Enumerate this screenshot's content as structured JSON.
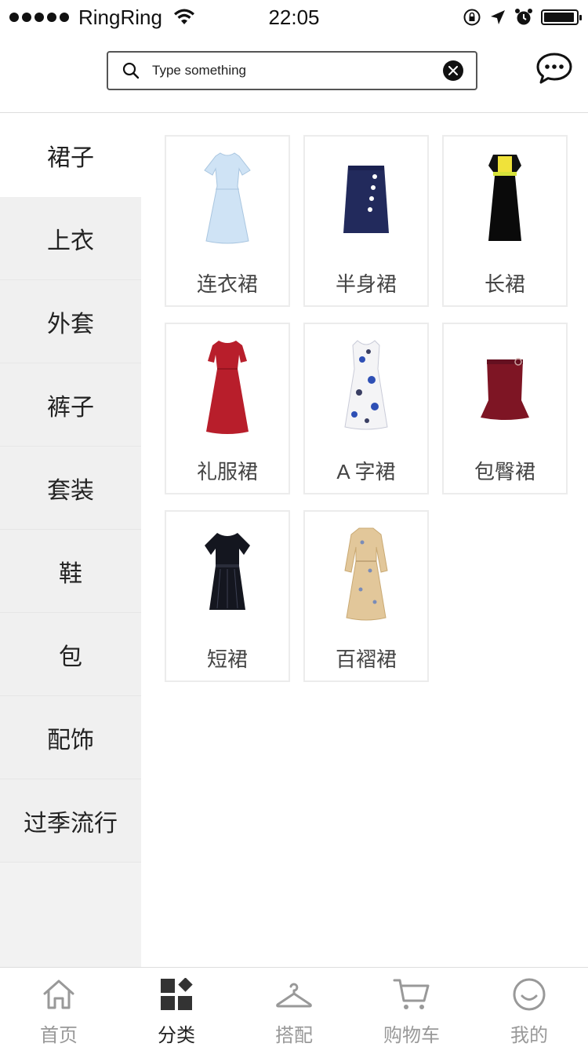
{
  "status_bar": {
    "carrier": "RingRing",
    "time": "22:05",
    "battery_level": 0.95
  },
  "search": {
    "placeholder": "Type something"
  },
  "sidebar": {
    "items": [
      {
        "label": "裙子"
      },
      {
        "label": "上衣"
      },
      {
        "label": "外套"
      },
      {
        "label": "裤子"
      },
      {
        "label": "套装"
      },
      {
        "label": "鞋"
      },
      {
        "label": "包"
      },
      {
        "label": "配饰"
      },
      {
        "label": "过季流行"
      }
    ],
    "active_index": 0
  },
  "products": [
    {
      "label": "连衣裙",
      "image": "light-blue-dress"
    },
    {
      "label": "半身裙",
      "image": "navy-skirt"
    },
    {
      "label": "长裙",
      "image": "black-long-dress"
    },
    {
      "label": "礼服裙",
      "image": "red-gown"
    },
    {
      "label": "A 字裙",
      "image": "floral-a-line-dress"
    },
    {
      "label": "包臀裙",
      "image": "burgundy-fishtail-skirt"
    },
    {
      "label": "短裙",
      "image": "black-striped-dress"
    },
    {
      "label": "百褶裙",
      "image": "beige-floral-pleated-dress"
    }
  ],
  "tabbar": {
    "items": [
      {
        "label": "首页",
        "icon": "home-icon"
      },
      {
        "label": "分类",
        "icon": "category-grid-icon"
      },
      {
        "label": "搭配",
        "icon": "hanger-icon"
      },
      {
        "label": "购物车",
        "icon": "cart-icon"
      },
      {
        "label": "我的",
        "icon": "smiley-icon"
      }
    ],
    "active_index": 1
  },
  "colors": {
    "sidebar_bg": "#f0f0f0",
    "active_tab": "#222222",
    "inactive_tab": "#999999"
  }
}
